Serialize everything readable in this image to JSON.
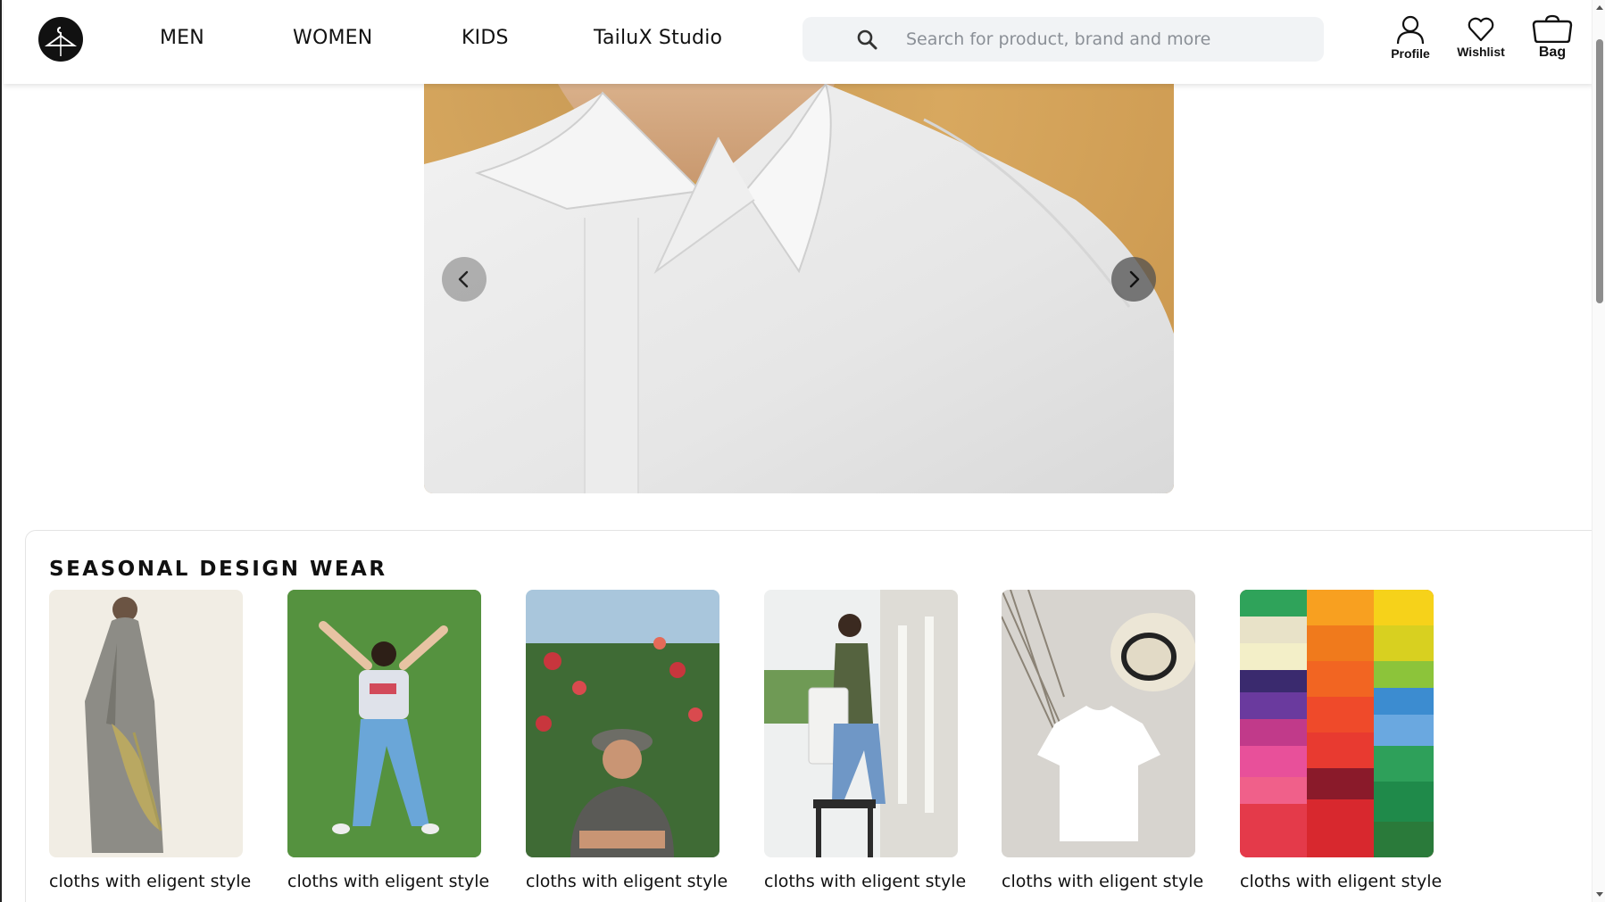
{
  "header": {
    "logo_icon": "hanger-logo-icon",
    "nav": [
      {
        "label": "MEN"
      },
      {
        "label": "WOMEN"
      },
      {
        "label": "KIDS"
      },
      {
        "label": "TailuX Studio"
      }
    ],
    "search": {
      "icon": "search-icon",
      "placeholder": "Search for product, brand and more",
      "value": ""
    },
    "actions": [
      {
        "label": "Profile",
        "icon": "user-icon"
      },
      {
        "label": "Wishlist",
        "icon": "heart-icon"
      },
      {
        "label": "Bag",
        "icon": "bag-icon"
      }
    ]
  },
  "hero": {
    "prev_icon": "chevron-left-icon",
    "next_icon": "chevron-right-icon"
  },
  "seasonal": {
    "title": "SEASONAL DESIGN WEAR",
    "cards": [
      {
        "caption": "cloths with eligent style",
        "sub": "..."
      },
      {
        "caption": "cloths with eligent style",
        "sub": "..."
      },
      {
        "caption": "cloths with eligent style",
        "sub": "..."
      },
      {
        "caption": "cloths with eligent style",
        "sub": "..."
      },
      {
        "caption": "cloths with eligent style",
        "sub": "..."
      },
      {
        "caption": "cloths with eligent style",
        "sub": "..."
      }
    ]
  },
  "colors": {
    "accent": "#111111",
    "search_bg": "#f1f3f5",
    "hero_bg": "#d4a25a"
  }
}
